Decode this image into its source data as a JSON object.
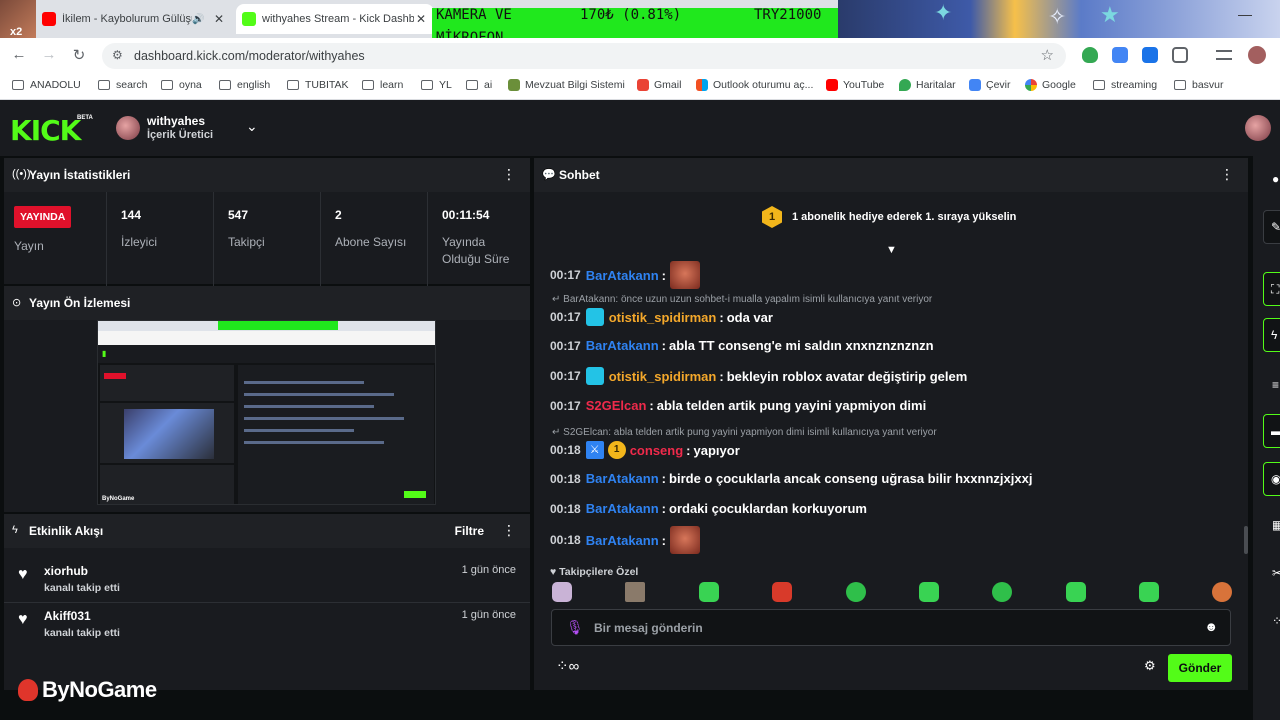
{
  "browser": {
    "corner_badge": "x2",
    "tabs": [
      {
        "title": "İkilem - Kaybolurum Gülüşü",
        "favicon_color": "#ff0000"
      },
      {
        "title": "withyahes Stream - Kick Dashboard",
        "favicon_color": "#53fc18"
      }
    ],
    "url": "dashboard.kick.com/moderator/withyahes",
    "bookmarks": [
      "ANADOLU",
      "search",
      "oyna",
      "english",
      "TUBITAK",
      "learn",
      "YL",
      "ai",
      "Mevzuat Bilgi Sistemi",
      "Gmail",
      "Outlook oturumu aç...",
      "YouTube",
      "Haritalar",
      "Çevir",
      "Google",
      "streaming",
      "basvur"
    ]
  },
  "overlay": {
    "line1": "KAMERA VE",
    "line2": "MİKROFON",
    "price": "170₺ (0.81%)",
    "goal": "TRY21000"
  },
  "header": {
    "logo": "KICK",
    "beta": "BETA",
    "channel_name": "withyahes",
    "channel_role": "İçerik Üretici"
  },
  "stats": {
    "title": "Yayın İstatistikleri",
    "live_label": "YAYINDA",
    "live_caption": "Yayın",
    "cells": [
      {
        "value": "144",
        "label": "İzleyici"
      },
      {
        "value": "547",
        "label": "Takipçi"
      },
      {
        "value": "2",
        "label": "Abone Sayısı"
      },
      {
        "value": "00:11:54",
        "label": "Yayında Olduğu Süre"
      }
    ]
  },
  "preview": {
    "title": "Yayın Ön İzlemesi"
  },
  "activity": {
    "title": "Etkinlik Akışı",
    "filter": "Filtre",
    "items": [
      {
        "user": "xiorhub",
        "action": "kanalı takip etti",
        "time": "1 gün önce"
      },
      {
        "user": "Akiff031",
        "action": "kanalı takip etti",
        "time": "1 gün önce"
      }
    ]
  },
  "watermark": "ByNoGame",
  "chat": {
    "title": "Sohbet",
    "sub_badge": "1",
    "sub_text": "1 abonelik hediye ederek 1. sıraya yükselin",
    "messages": [
      {
        "time": "00:17",
        "user": "BarAtakann",
        "text": ""
      },
      {
        "reply": "BarAtakann: önce uzun uzun sohbet-i mualla yapalım isimli kullanıcıya yanıt veriyor"
      },
      {
        "time": "00:17",
        "user": "otistik_spidirman",
        "text": "oda var"
      },
      {
        "time": "00:17",
        "user": "BarAtakann",
        "text": "abla TT conseng'e mi saldın xnxnznznznzn"
      },
      {
        "time": "00:17",
        "user": "otistik_spidirman",
        "text": "bekleyin roblox avatar değiştirip gelem"
      },
      {
        "time": "00:17",
        "user": "S2GElcan",
        "text": "abla telden artik pung yayini yapmiyon dimi"
      },
      {
        "reply": "S2GElcan: abla telden artik pung yayini yapmiyon dimi isimli kullanıcıya yanıt veriyor"
      },
      {
        "time": "00:18",
        "user": "conseng",
        "text": "yapıyor",
        "badge": "1"
      },
      {
        "time": "00:18",
        "user": "BarAtakann",
        "text": "birde o çocuklarla ancak conseng uğrasa bilir hxxnnzjxjxxj"
      },
      {
        "time": "00:18",
        "user": "BarAtakann",
        "text": "ordaki çocuklardan korkuyorum"
      },
      {
        "time": "00:18",
        "user": "BarAtakann",
        "text": ""
      }
    ],
    "followers_label": "Takipçilere Özel",
    "input_placeholder": "Bir mesaj gönderin",
    "send_label": "Gönder"
  },
  "colors": {
    "accent": "#53fc18",
    "live": "#e0112b",
    "user_blue": "#2f83f2",
    "user_orange": "#f4a82b",
    "user_red": "#ef2a4b"
  }
}
